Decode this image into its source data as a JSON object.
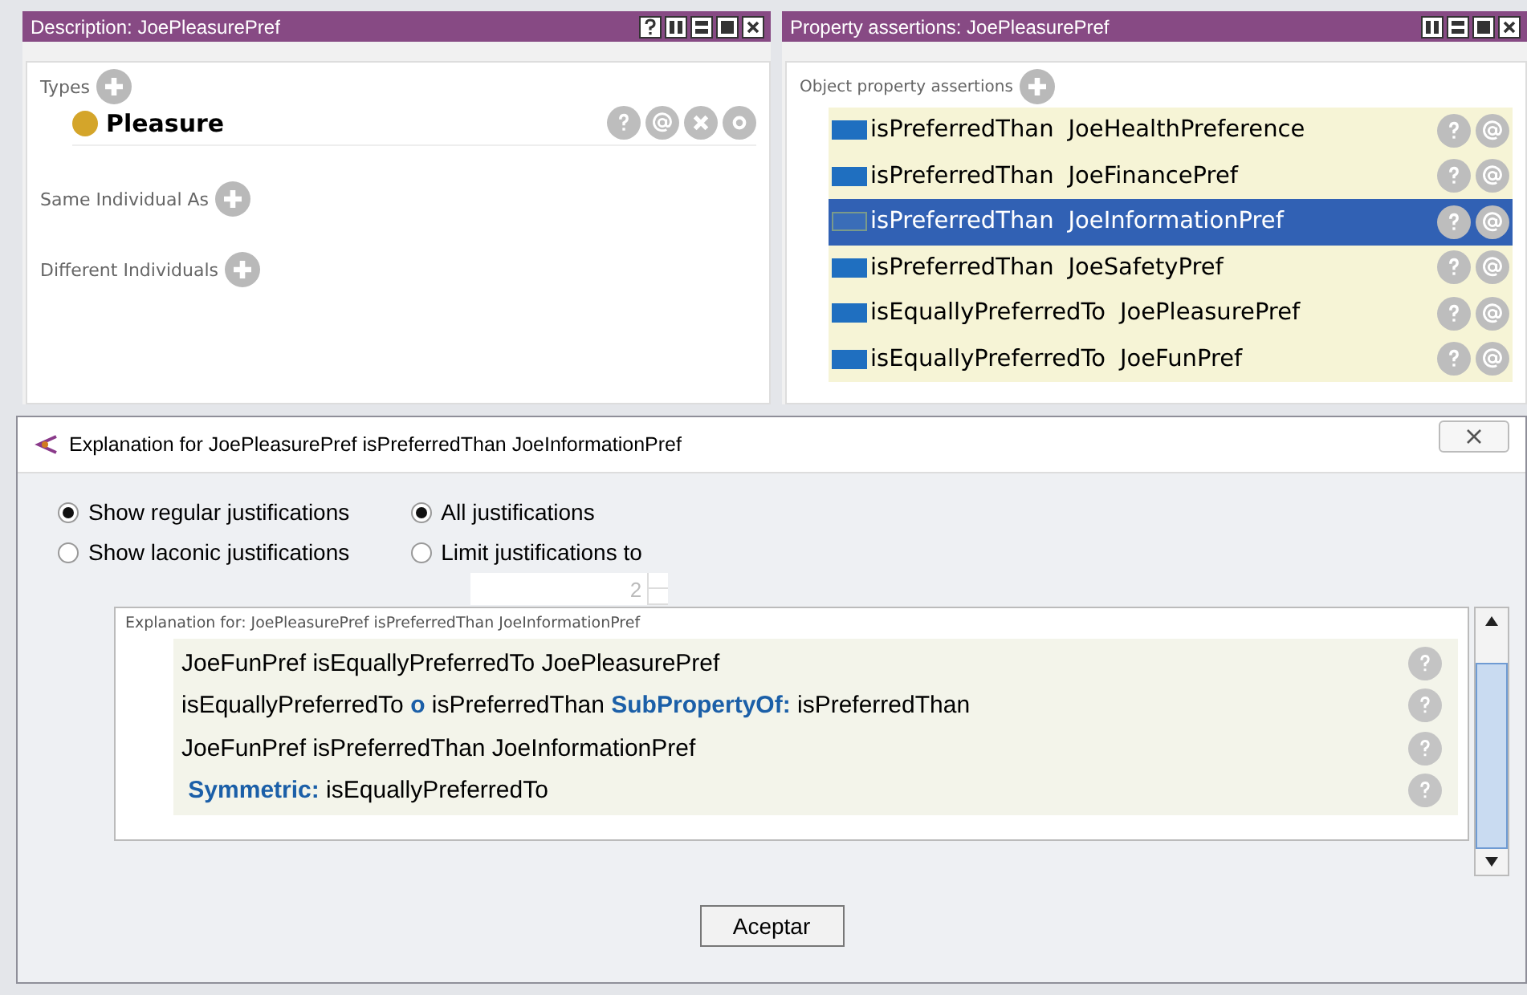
{
  "description_panel": {
    "title": "Description: JoePleasurePref",
    "sections": [
      {
        "label": "Types",
        "items": [
          {
            "text": "Pleasure",
            "color": "#d4a52a"
          }
        ]
      },
      {
        "label": "Same Individual As"
      },
      {
        "label": "Different Individuals"
      }
    ]
  },
  "property_panel": {
    "title": "Property assertions: JoePleasurePref",
    "section_label": "Object property assertions",
    "assertions": [
      {
        "property": "isPreferredThan",
        "value": "JoeHealthPreference",
        "selected": false
      },
      {
        "property": "isPreferredThan",
        "value": "JoeFinancePref",
        "selected": false
      },
      {
        "property": "isPreferredThan",
        "value": "JoeInformationPref",
        "selected": true
      },
      {
        "property": "isPreferredThan",
        "value": "JoeSafetyPref",
        "selected": false
      },
      {
        "property": "isEquallyPreferredTo",
        "value": "JoePleasurePref",
        "selected": false
      },
      {
        "property": "isEquallyPreferredTo",
        "value": "JoeFunPref",
        "selected": false
      }
    ]
  },
  "dialog": {
    "title": "Explanation for JoePleasurePref isPreferredThan JoeInformationPref",
    "justification_type": [
      {
        "label": "Show regular justifications",
        "selected": true
      },
      {
        "label": "Show laconic justifications",
        "selected": false
      }
    ],
    "justification_limit": [
      {
        "label": "All justifications",
        "selected": true
      },
      {
        "label": "Limit justifications to",
        "selected": false
      }
    ],
    "limit_value": "2",
    "explanation_header": "Explanation for: JoePleasurePref isPreferredThan JoeInformationPref",
    "lines": [
      "JoeFunPref isEquallyPreferredTo JoePleasurePref",
      "isEquallyPreferredTo **o** isPreferredThan **SubPropertyOf:** isPreferredThan",
      "JoeFunPref isPreferredThan JoeInformationPref",
      " **Symmetric:** isEquallyPreferredTo"
    ],
    "ok_button": "Aceptar"
  }
}
